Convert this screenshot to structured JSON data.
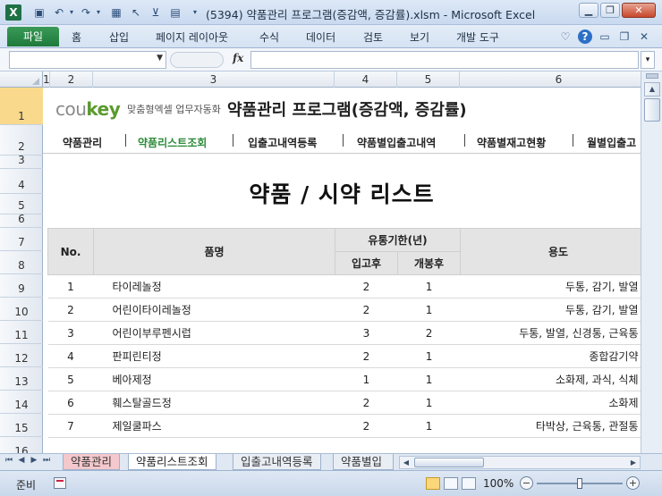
{
  "window": {
    "title": "(5394) 약품관리 프로그램(증감액, 증감률).xlsm  -  Microsoft Excel"
  },
  "ribbon": {
    "file_tab": "파일",
    "tabs": [
      "홈",
      "삽입",
      "페이지 레이아웃",
      "수식",
      "데이터",
      "검토",
      "보기",
      "개발 도구"
    ]
  },
  "formula_bar": {
    "fx": "fx"
  },
  "columns": [
    "1",
    "2",
    "3",
    "4",
    "5",
    "6"
  ],
  "rows": [
    "1",
    "2",
    "3",
    "4",
    "5",
    "6",
    "7",
    "8",
    "9",
    "10",
    "11",
    "12",
    "13",
    "14",
    "15",
    "16"
  ],
  "sheet": {
    "logo": "coukey",
    "logo_sub": "맞춤형엑셀 업무자동화",
    "app_title": "약품관리 프로그램(증감액, 증감률)",
    "nav": [
      "약품관리",
      "약품리스트조회",
      "입출고내역등록",
      "약품별입출고내역",
      "약품별재고현황",
      "월별입출고"
    ],
    "heading": "약품 / 시약 리스트",
    "table": {
      "headers": {
        "no": "No.",
        "name": "품명",
        "expiry": "유통기한(년)",
        "after_receipt": "입고후",
        "after_open": "개봉후",
        "use": "용도"
      },
      "rows": [
        {
          "no": "1",
          "name": "타이레놀정",
          "after_receipt": "2",
          "after_open": "1",
          "use": "두통, 감기, 발열"
        },
        {
          "no": "2",
          "name": "어린이타이레놀정",
          "after_receipt": "2",
          "after_open": "1",
          "use": "두통, 감기, 발열"
        },
        {
          "no": "3",
          "name": "어린이부루펜시럽",
          "after_receipt": "3",
          "after_open": "2",
          "use": "두통, 발열, 신경통, 근육통"
        },
        {
          "no": "4",
          "name": "판피린티정",
          "after_receipt": "2",
          "after_open": "1",
          "use": "종합감기약"
        },
        {
          "no": "5",
          "name": "베아제정",
          "after_receipt": "1",
          "after_open": "1",
          "use": "소화제, 과식, 식체"
        },
        {
          "no": "6",
          "name": "훼스탈골드정",
          "after_receipt": "2",
          "after_open": "1",
          "use": "소화제"
        },
        {
          "no": "7",
          "name": "제일쿨파스",
          "after_receipt": "2",
          "after_open": "1",
          "use": "타박상, 근육통, 관절통"
        }
      ]
    }
  },
  "sheet_tabs": [
    "약품관리",
    "약품리스트조회",
    "입출고내역등록",
    "약품별입"
  ],
  "status": {
    "ready": "준비",
    "zoom": "100%"
  }
}
